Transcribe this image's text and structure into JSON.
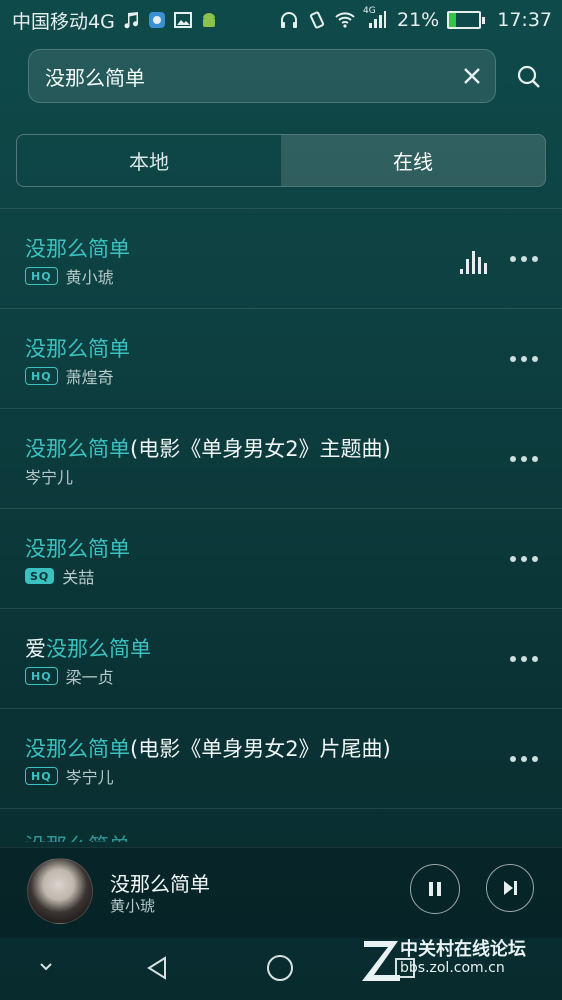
{
  "status_bar": {
    "carrier": "中国移动4G",
    "network_badge": "4G",
    "battery_percent": "21%",
    "battery_level": 0.21,
    "time": "17:37"
  },
  "search": {
    "query": "没那么简单"
  },
  "tabs": [
    {
      "label": "本地",
      "active": false
    },
    {
      "label": "在线",
      "active": true
    }
  ],
  "results": [
    {
      "prefix": "",
      "highlight": "没那么简单",
      "suffix": "",
      "badge": "HQ",
      "artist": "黄小琥",
      "playing": true
    },
    {
      "prefix": "",
      "highlight": "没那么简单",
      "suffix": "",
      "badge": "HQ",
      "artist": "萧煌奇",
      "playing": false
    },
    {
      "prefix": "",
      "highlight": "没那么简单",
      "suffix": "(电影《单身男女2》主题曲)",
      "badge": "",
      "artist": "岑宁儿",
      "playing": false
    },
    {
      "prefix": "",
      "highlight": "没那么简单",
      "suffix": "",
      "badge": "SQ",
      "artist": "关喆",
      "playing": false
    },
    {
      "prefix": "爱",
      "highlight": "没那么简单",
      "suffix": "",
      "badge": "HQ",
      "artist": "梁一贞",
      "playing": false
    },
    {
      "prefix": "",
      "highlight": "没那么简单",
      "suffix": "(电影《单身男女2》片尾曲)",
      "badge": "HQ",
      "artist": "岑宁儿",
      "playing": false
    }
  ],
  "partial_row_title": "没那么简单",
  "now_playing": {
    "title": "没那么简单",
    "artist": "黄小琥"
  },
  "watermark": {
    "title": "中关村在线论坛",
    "url": "bbs.zol.com.cn"
  },
  "colors": {
    "accent": "#3bc1c0",
    "background": "#0d3f40"
  }
}
